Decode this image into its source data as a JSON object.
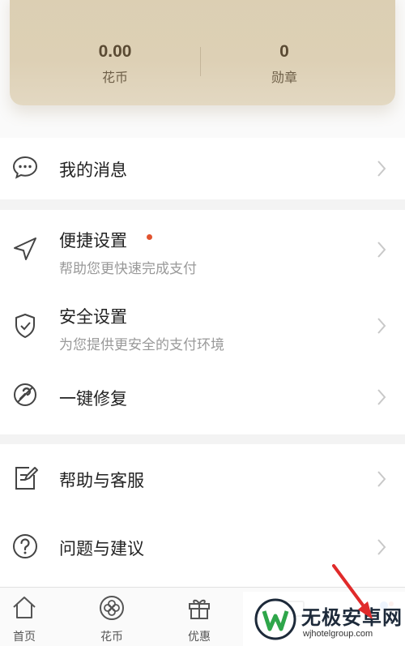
{
  "stats": {
    "coins_value": "0.00",
    "coins_label": "花币",
    "badges_value": "0",
    "badges_label": "勋章"
  },
  "menu": {
    "messages": {
      "title": "我的消息",
      "icon": "chat-bubble-icon"
    },
    "quick_settings": {
      "title": "便捷设置",
      "subtitle": "帮助您更快速完成支付",
      "icon": "send-arrow-icon",
      "has_dot": true
    },
    "security_settings": {
      "title": "安全设置",
      "subtitle": "为您提供更安全的支付环境",
      "icon": "shield-check-icon"
    },
    "one_click_repair": {
      "title": "一键修复",
      "icon": "repair-icon"
    },
    "help_service": {
      "title": "帮助与客服",
      "icon": "edit-document-icon"
    },
    "feedback": {
      "title": "问题与建议",
      "icon": "question-circle-icon"
    }
  },
  "tabbar": {
    "home": "首页",
    "coins": "花币",
    "offers": "优惠"
  },
  "watermark": {
    "name": "无极安卓网",
    "url": "wjhotelgroup.com"
  },
  "colors": {
    "card_gold": "#ddd0b5",
    "red_dot": "#e1532f",
    "annotation_arrow": "#e02a2a"
  }
}
